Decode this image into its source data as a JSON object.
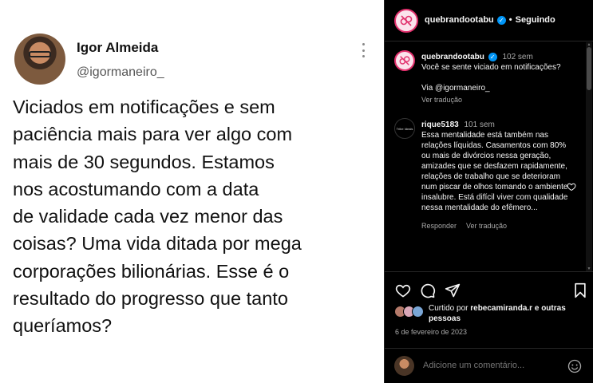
{
  "tweet": {
    "name": "Igor Almeida",
    "handle": "@igormaneiro_",
    "text": "Viciados em notificações e sem\npaciência mais para ver algo com\nmais de 30 segundos. Estamos\nnos acostumando com a data\nde validade cada vez menor das\ncoisas? Uma vida ditada por mega\ncorporações bilionárias. Esse é o\nresultado do progresso que tanto\nqueríamos?"
  },
  "header": {
    "username": "quebrandootabu",
    "separator": "•",
    "follow_label": "Seguindo"
  },
  "caption": {
    "username": "quebrandootabu",
    "time": "102 sem",
    "text": "Você se sente viciado em notificações?\n\nVia @igormaneiro_",
    "translate": "Ver tradução"
  },
  "comment": {
    "avatar_text": "Tribe Ideals",
    "username": "rique5183",
    "time": "101 sem",
    "text": "Essa mentalidade está também nas relações líquidas. Casamentos com 80% ou mais de divórcios nessa geração, amizades que se desfazem rapidamente, relações de trabalho que se deterioram num piscar de olhos tomando o ambiente insalubre. Está difícil viver com qualidade nessa mentalidade do efêmero...",
    "reply": "Responder",
    "translate": "Ver tradução"
  },
  "liked": {
    "prefix": "Curtido por",
    "user": "rebecamiranda.r",
    "conj": "e",
    "others": "outras pessoas"
  },
  "date": "6 de fevereiro de 2023",
  "add_comment": {
    "placeholder": "Adicione um comentário..."
  },
  "colors": {
    "background": "#000000",
    "accent": "#0095f6",
    "brand": "#e1306c",
    "muted": "#a8a8a8"
  }
}
